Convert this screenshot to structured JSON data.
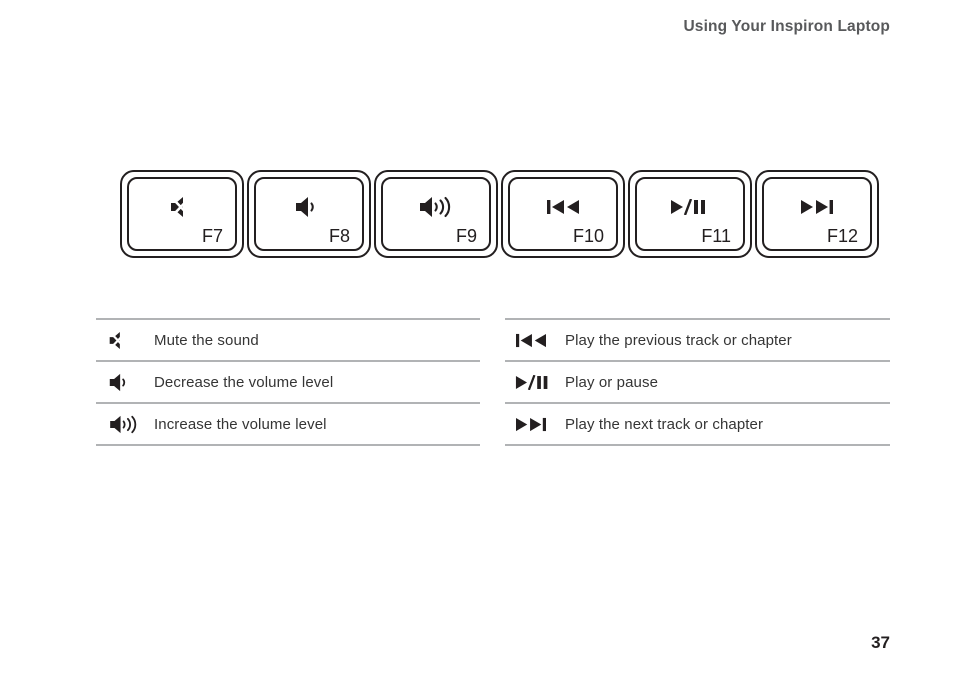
{
  "header": {
    "title": "Using Your Inspiron Laptop"
  },
  "keys": [
    {
      "label": "F7",
      "icon": "mute-icon",
      "icon_title": "Mute"
    },
    {
      "label": "F8",
      "icon": "volume-down-icon",
      "icon_title": "Decrease volume"
    },
    {
      "label": "F9",
      "icon": "volume-up-icon",
      "icon_title": "Increase volume"
    },
    {
      "label": "F10",
      "icon": "previous-track-icon",
      "icon_title": "Previous track"
    },
    {
      "label": "F11",
      "icon": "play-pause-icon",
      "icon_title": "Play or pause"
    },
    {
      "label": "F12",
      "icon": "next-track-icon",
      "icon_title": "Next track"
    }
  ],
  "legend_left": {
    "rows": [
      {
        "icon": "mute-icon",
        "text": "Mute the sound"
      },
      {
        "icon": "volume-down-icon",
        "text": "Decrease the volume level"
      },
      {
        "icon": "volume-up-icon",
        "text": "Increase the volume level"
      }
    ]
  },
  "legend_right": {
    "rows": [
      {
        "icon": "previous-track-icon",
        "text": "Play the previous track or chapter"
      },
      {
        "icon": "play-pause-icon",
        "text": "Play or pause"
      },
      {
        "icon": "next-track-icon",
        "text": "Play the next track or chapter"
      }
    ]
  },
  "footer": {
    "page_number": "37"
  },
  "colors": {
    "header_text": "#58595b",
    "body_text": "#353535",
    "ink": "#231f20",
    "rule": "#b1b3b5",
    "background": "#ffffff"
  }
}
